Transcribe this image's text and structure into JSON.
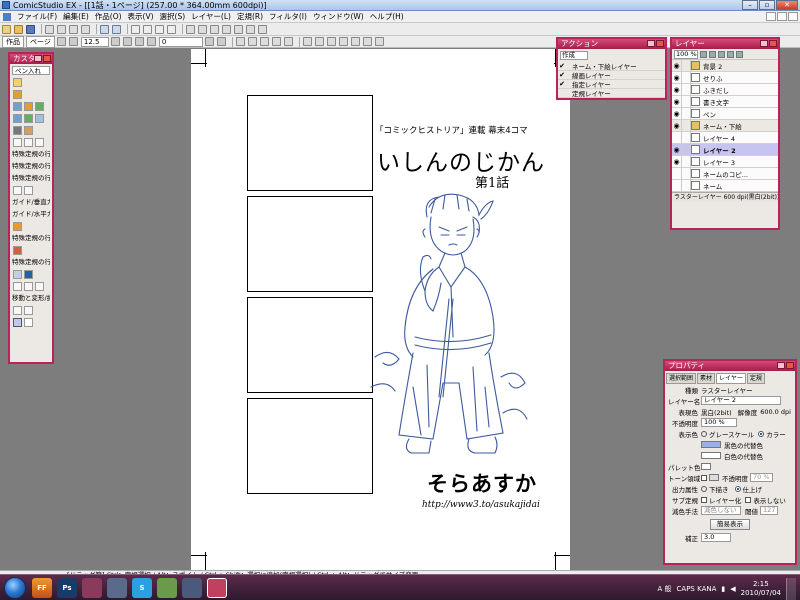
{
  "window": {
    "title": "ComicStudio EX - [[1話・1ページ] (257.00 * 364.00mm 600dpi)]"
  },
  "menu": {
    "items": [
      "ファイル(F)",
      "編集(E)",
      "作品(O)",
      "表示(V)",
      "選択(S)",
      "レイヤー(L)",
      "定規(R)",
      "フィルタ(I)",
      "ウィンドウ(W)",
      "ヘルプ(H)"
    ]
  },
  "toolbar2": {
    "tab_work": "作品",
    "tab_page": "ページ",
    "zoom_value": "12.5",
    "angle_value": "0"
  },
  "canvas": {
    "subtitle": "「コミックヒストリア」連載 幕末4コマ",
    "title": "いしんのじかん",
    "episode": "第1話",
    "author": "そらあすか",
    "url": "http://www3.to/asukajidai"
  },
  "custom_palette": {
    "title": "カスタム...",
    "dropdown": "ペン入れ",
    "labels": [
      "特殊定規の行IN",
      "特殊定規の行IN",
      "特殊定規の行IN",
      "ガイド/垂直ガイ",
      "ガイド/水平ガイ",
      "特殊定規の行IN",
      "特殊定規の行IN",
      "移動と変形/拡"
    ]
  },
  "action_palette": {
    "title": "アクション",
    "dropdown": "作成",
    "rows": [
      {
        "checked": true,
        "label": "ネーム・下絵レイヤー"
      },
      {
        "checked": true,
        "label": "線画レイヤー"
      },
      {
        "checked": true,
        "label": "指定レイヤー"
      },
      {
        "checked": false,
        "label": "定規レイヤー"
      }
    ]
  },
  "layer_palette": {
    "title": "レイヤー",
    "zoom": "100 %",
    "rows": [
      {
        "name": "背景 2",
        "visible": true,
        "selected": false,
        "folder": true
      },
      {
        "name": "せりふ",
        "visible": true,
        "selected": false,
        "folder": false
      },
      {
        "name": "ふきだし",
        "visible": true,
        "selected": false,
        "folder": false
      },
      {
        "name": "書き文字",
        "visible": true,
        "selected": false,
        "folder": false
      },
      {
        "name": "ペン",
        "visible": true,
        "selected": false,
        "folder": false
      },
      {
        "name": "ネーム・下絵",
        "visible": true,
        "selected": false,
        "folder": true
      },
      {
        "name": "レイヤー 4",
        "visible": false,
        "selected": false,
        "folder": false
      },
      {
        "name": "レイヤー 2",
        "visible": true,
        "selected": true,
        "folder": false
      },
      {
        "name": "レイヤー 3",
        "visible": true,
        "selected": false,
        "folder": false
      },
      {
        "name": "ネームのコピ...",
        "visible": false,
        "selected": false,
        "folder": false
      },
      {
        "name": "ネーム",
        "visible": false,
        "selected": false,
        "folder": false
      }
    ],
    "status": "ラスターレイヤー 600 dpi(黒白(2bit))仕上..."
  },
  "property_palette": {
    "title": "プロパティ",
    "tabs": [
      "選択範囲",
      "素材",
      "レイヤー",
      "定規"
    ],
    "active_tab": "レイヤー",
    "kind_label": "種類",
    "kind_value": "ラスターレイヤー",
    "name_label": "レイヤー名",
    "name_value": "レイヤー 2",
    "color_label": "表現色",
    "color_value": "黒白(2bit)",
    "res_label": "解像度",
    "res_value": "600.0 dpi",
    "opacity_label": "不透明度",
    "opacity_value": "100 %",
    "display_label": "表示色",
    "grayscale": "グレースケール",
    "color_opt": "カラー",
    "black_sub": "黒色の代替色",
    "white_sub": "白色の代替色",
    "palette_label": "パレット色",
    "tone_label": "トーン領域",
    "tone_opacity_label": "不透明度",
    "tone_opacity_value": "70 %",
    "output_label": "出力属性",
    "draft": "下描き",
    "finish": "仕上げ",
    "sub_label": "サブ定規",
    "layerize": "レイヤー化",
    "hide": "表示しない",
    "reduce_label": "減色手法",
    "reduce_value": "減色しない",
    "threshold_label": "閾値",
    "threshold_value": "127",
    "simple_button": "簡易表示",
    "correction_label": "補正",
    "correction_value": "3.0"
  },
  "status_bar": "[ドラッグ範] Ctrl：定規選択 / Alt：スポイト / Ctrl + Shift：選択に追加(定規選択) / Ctrl + Alt：ドラッグでサイズ変更",
  "taskbar": {
    "apps": [
      "FF",
      "Ps",
      "",
      "",
      "S",
      "",
      "",
      ""
    ],
    "ime": "A 般",
    "caps": "CAPS KANA",
    "time": "2:15",
    "date": "2010/07/04"
  },
  "colors": {
    "palette_title": "#b8245a",
    "selected_layer": "#c8c4f0",
    "line_art": "#3d5a9c"
  }
}
